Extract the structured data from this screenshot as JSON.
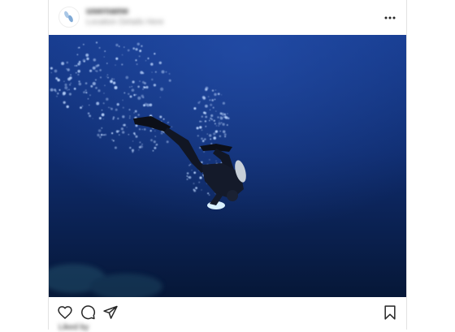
{
  "post": {
    "username": "username",
    "subtitle": "Location Details Here",
    "likes_text": "Liked by"
  },
  "icons": {
    "avatar": "feet-icon",
    "more": "more-horizontal-icon",
    "like": "heart-icon",
    "comment": "comment-icon",
    "share": "send-icon",
    "save": "bookmark-icon"
  },
  "photo": {
    "subject": "scuba diver underwater with rising bubbles"
  },
  "colors": {
    "water_top": "#12307a",
    "water_bottom": "#061a3e",
    "icon": "#262626",
    "border": "#e3e3e3"
  }
}
